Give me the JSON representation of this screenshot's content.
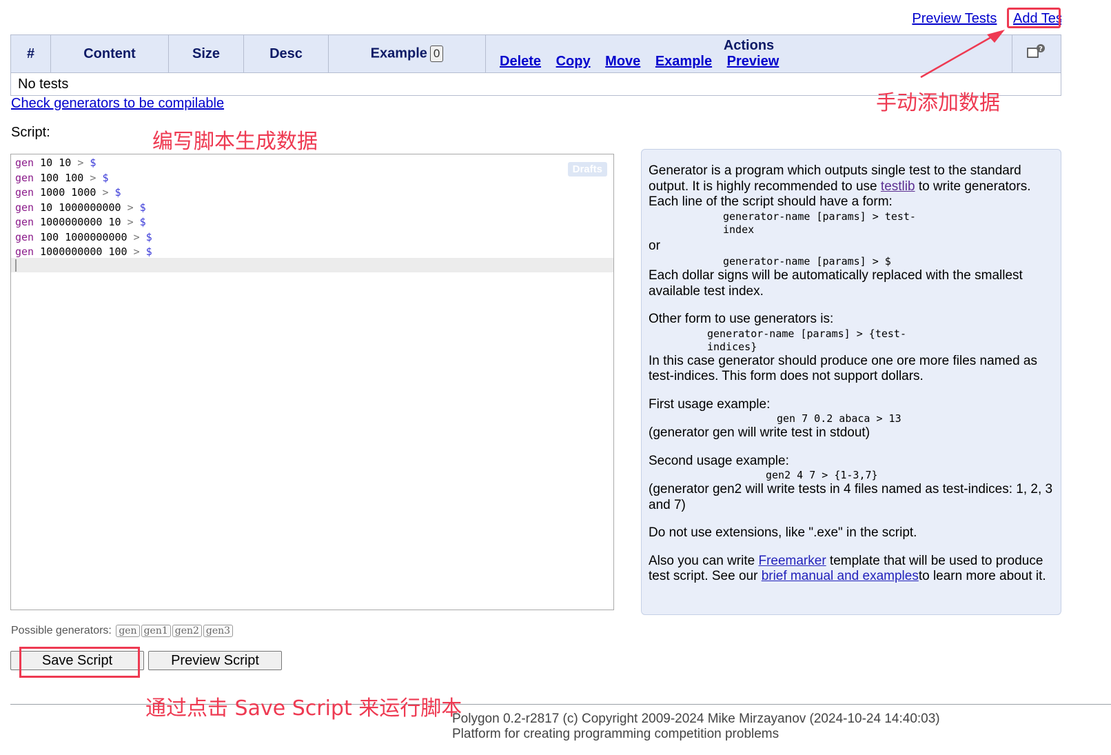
{
  "top_links": {
    "preview_tests": "Preview Tests",
    "add_test": "Add Tes"
  },
  "table": {
    "headers": {
      "num": "#",
      "content": "Content",
      "size": "Size",
      "desc": "Desc",
      "example": "Example",
      "example_count": "0",
      "actions": "Actions"
    },
    "actions": {
      "delete": "Delete",
      "copy": "Copy",
      "move": "Move",
      "example": "Example",
      "preview": "Preview"
    },
    "empty_text": "No tests"
  },
  "check_link": "Check generators to be compilable",
  "script_label": "Script:",
  "editor": {
    "drafts_label": "Drafts",
    "lines": [
      {
        "cmd": "gen",
        "args": " 10 10 ",
        "arrow": ">",
        "dollar": "$"
      },
      {
        "cmd": "gen",
        "args": " 100 100 ",
        "arrow": ">",
        "dollar": "$"
      },
      {
        "cmd": "gen",
        "args": " 1000 1000 ",
        "arrow": ">",
        "dollar": "$"
      },
      {
        "cmd": "gen",
        "args": " 10 1000000000 ",
        "arrow": ">",
        "dollar": "$"
      },
      {
        "cmd": "gen",
        "args": " 1000000000 10 ",
        "arrow": ">",
        "dollar": "$"
      },
      {
        "cmd": "gen",
        "args": " 100 1000000000 ",
        "arrow": ">",
        "dollar": "$"
      },
      {
        "cmd": "gen",
        "args": " 1000000000 100 ",
        "arrow": ">",
        "dollar": "$"
      }
    ]
  },
  "help": {
    "p1a": "Generator is a program which outputs single test to the standard output. It is highly recommended to use ",
    "testlib": "testlib",
    "p1b": " to write generators.",
    "p2": "Each line of the script should have a form:",
    "form1": "generator-name [params] > test-index",
    "or": "or",
    "form2": "generator-name [params] > $",
    "p3": "Each dollar signs will be automatically replaced with the smallest available test index.",
    "p4": "Other form to use generators is:",
    "form3": "generator-name [params] > {test-indices}",
    "p5": "In this case generator should produce one ore more files named as test-indices. This form does not support dollars.",
    "ex1_title": "First usage example:",
    "ex1_code": "gen 7 0.2 abaca > 13",
    "ex1_desc": "(generator gen will write test in stdout)",
    "ex2_title": "Second usage example:",
    "ex2_code": "gen2 4 7 > {1-3,7}",
    "ex2_desc": "(generator gen2 will write tests in 4 files named as test-indices: 1, 2, 3 and 7)",
    "p6": "Do not use extensions, like \".exe\" in the script.",
    "p7a": "Also you can write ",
    "freemarker": "Freemarker",
    "p7b": " template that will be used to produce test script. See our ",
    "manual": "brief manual and examples",
    "p7c": "to learn more about it."
  },
  "possible_label": "Possible generators:",
  "generators": [
    "gen",
    "gen1",
    "gen2",
    "gen3"
  ],
  "buttons": {
    "save": "Save Script",
    "preview": "Preview Script"
  },
  "footer": {
    "line1": "Polygon 0.2-r2817 (c) Copyright 2009-2024 Mike Mirzayanov (2024-10-24 14:40:03)",
    "line2": "Platform for creating programming competition problems"
  },
  "annotations": {
    "add_data": "手动添加数据",
    "write_script": "编写脚本生成数据",
    "run_script": "通过点击 Save Script 来运行脚本"
  },
  "colors": {
    "annotation": "#ee3a52",
    "header_bg": "#e1e8f7",
    "help_bg": "#e9eef9",
    "link": "#0000cc"
  }
}
